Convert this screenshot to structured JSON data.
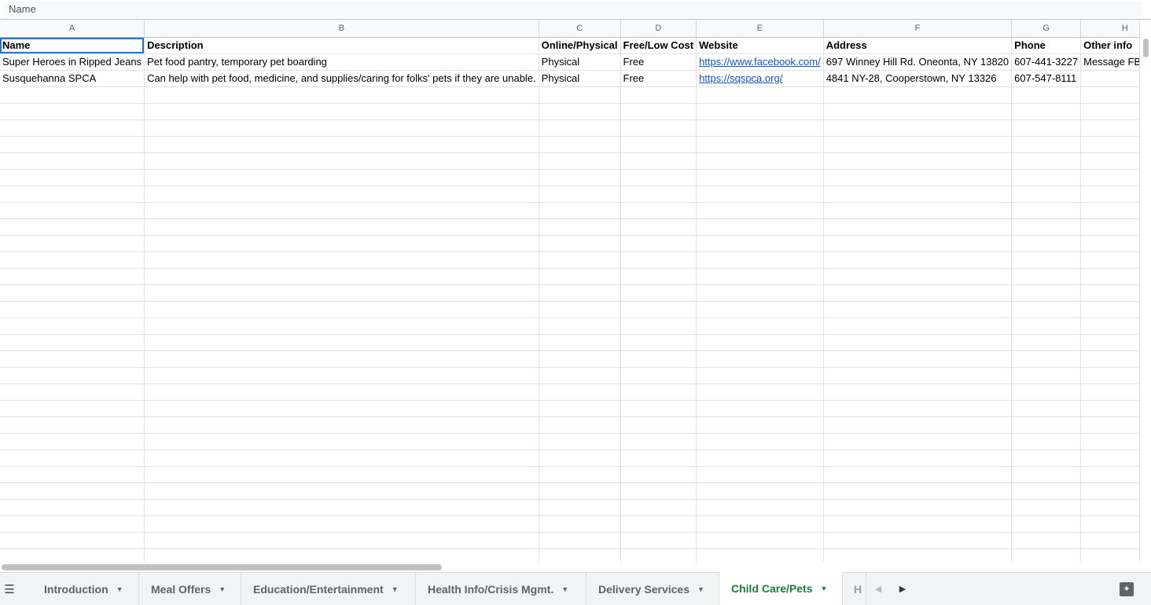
{
  "formula_bar": {
    "value": "Name"
  },
  "columns": [
    "A",
    "B",
    "C",
    "D",
    "E",
    "F",
    "G",
    "H"
  ],
  "header_row": [
    "Name",
    "Description",
    "Online/Physical",
    "Free/Low Cost",
    "Website",
    "Address",
    "Phone",
    "Other info"
  ],
  "rows": [
    [
      "Super Heroes in Ripped Jeans",
      "Pet food pantry, temporary pet boarding",
      "Physical",
      "Free",
      "https://www.facebook.com/",
      "697 Winney Hill Rd. Oneonta, NY 13820",
      "607-441-3227",
      "Message FB page"
    ],
    [
      "Susquehanna SPCA",
      "Can help with pet food, medicine, and supplies/caring for folks' pets if they are unable.",
      "Physical",
      "Free",
      "https://sqspca.org/",
      "4841 NY-28, Cooperstown, NY 13326",
      "607-547-8111",
      ""
    ]
  ],
  "tabs": [
    {
      "label": "Introduction",
      "active": false
    },
    {
      "label": "Meal Offers",
      "active": false
    },
    {
      "label": "Education/Entertainment",
      "active": false
    },
    {
      "label": "Health Info/Crisis Mgmt.",
      "active": false
    },
    {
      "label": "Delivery Services",
      "active": false
    },
    {
      "label": "Child Care/Pets",
      "active": true
    },
    {
      "label": "H",
      "active": false
    }
  ],
  "icons": {
    "all_sheets": "menu-icon",
    "caret": "caret-down-icon",
    "scroll_left": "arrow-left-icon",
    "scroll_right": "arrow-right-icon",
    "explore": "explore-icon"
  },
  "colors": {
    "active_tab": "#188038",
    "link": "#1155cc",
    "selection": "#1a73e8"
  }
}
